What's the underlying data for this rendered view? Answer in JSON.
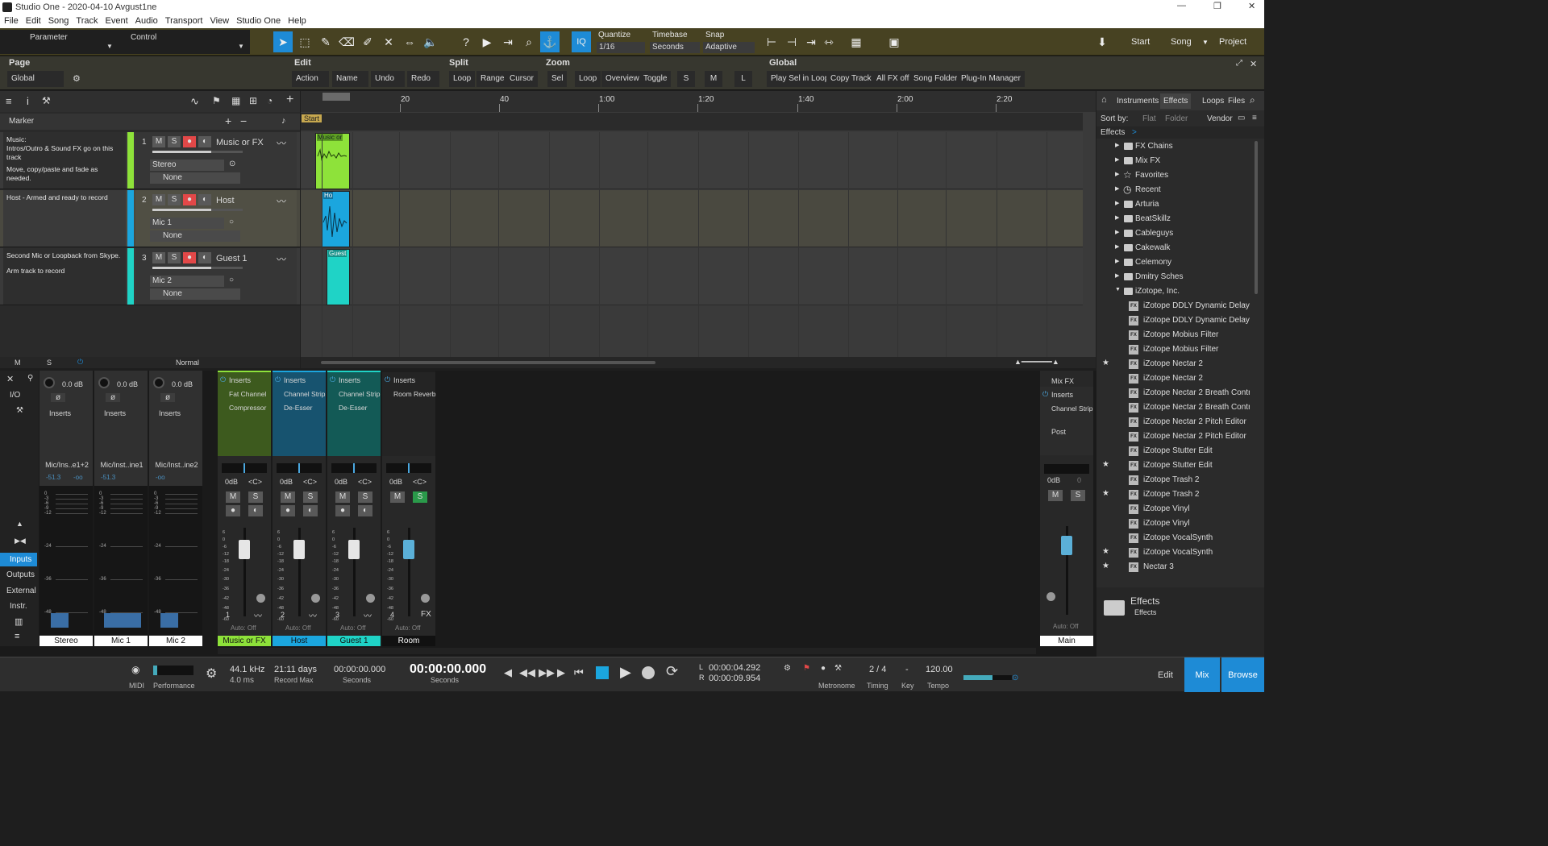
{
  "window": {
    "title": "Studio One - 2020-04-10 Avgust1ne"
  },
  "menu": [
    "File",
    "Edit",
    "Song",
    "Track",
    "Event",
    "Audio",
    "Transport",
    "View",
    "Studio One",
    "Help"
  ],
  "toolbar": {
    "parameter": "Parameter",
    "control": "Control",
    "quantize_label": "Quantize",
    "quantize_value": "1/16",
    "timebase_label": "Timebase",
    "timebase_value": "Seconds",
    "snap_label": "Snap",
    "snap_value": "Adaptive",
    "iq": "IQ",
    "start": "Start",
    "song": "Song",
    "project": "Project"
  },
  "editbar": {
    "page_label": "Page",
    "page_value": "Global",
    "edit_label": "Edit",
    "action": "Action",
    "name": "Name",
    "undo": "Undo",
    "redo": "Redo",
    "split_label": "Split",
    "loop": "Loop",
    "range": "Range",
    "cursor": "Cursor",
    "zoom_label": "Zoom",
    "sel": "Sel",
    "zloop": "Loop",
    "overview": "Overview",
    "toggle": "Toggle",
    "s": "S",
    "m": "M",
    "l": "L",
    "global_label": "Global",
    "play_sel_loop": "Play Sel in Loop",
    "copy_track": "Copy Track",
    "all_fx_off": "All FX off",
    "song_folder": "Song Folder",
    "plugin_manager": "Plug-In Manager"
  },
  "marker": {
    "label": "Marker"
  },
  "tracks": [
    {
      "num": "1",
      "name": "Music or FX",
      "note1": "Music:",
      "note2": "Intros/Outro & Sound FX go on this track",
      "note3": "Move, copy/paste and fade as needed.",
      "input": "Stereo",
      "output": "None",
      "color": "#8ee23a",
      "clip": "Music or"
    },
    {
      "num": "2",
      "name": "Host",
      "note1": "Host - Armed and ready to record",
      "note2": "",
      "note3": "",
      "input": "Mic 1",
      "output": "None",
      "color": "#1ba6de",
      "clip": "Ho"
    },
    {
      "num": "3",
      "name": "Guest 1",
      "note1": "Second Mic or Loopback from Skype.",
      "note2": "Arm track to record",
      "note3": "",
      "input": "Mic 2",
      "output": "None",
      "color": "#1fd3c6",
      "clip": "Guest"
    }
  ],
  "tl_footer": {
    "m": "M",
    "s": "S",
    "mode": "Normal"
  },
  "ruler": {
    "start": "Start",
    "ticks": [
      "20",
      "40",
      "1:00",
      "1:20",
      "1:40",
      "2:00",
      "2:20"
    ]
  },
  "browser": {
    "tabs": [
      "Instruments",
      "Effects",
      "Loops",
      "Files"
    ],
    "sort_label": "Sort by:",
    "sort_flat": "Flat",
    "sort_folder": "Folder",
    "sort_vendor": "Vendor",
    "path": "Effects",
    "items": [
      {
        "label": "FX Chains",
        "kind": "folder",
        "star": false
      },
      {
        "label": "Mix FX",
        "kind": "folder",
        "star": false
      },
      {
        "label": "Favorites",
        "kind": "star",
        "star": false
      },
      {
        "label": "Recent",
        "kind": "clock",
        "star": false
      },
      {
        "label": "Arturia",
        "kind": "folder",
        "star": false
      },
      {
        "label": "BeatSkillz",
        "kind": "folder",
        "star": false
      },
      {
        "label": "Cableguys",
        "kind": "folder",
        "star": false
      },
      {
        "label": "Cakewalk",
        "kind": "folder",
        "star": false
      },
      {
        "label": "Celemony",
        "kind": "folder",
        "star": false
      },
      {
        "label": "Dmitry Sches",
        "kind": "folder",
        "star": false
      },
      {
        "label": "iZotope, Inc.",
        "kind": "openfolder",
        "star": false
      },
      {
        "label": "iZotope DDLY Dynamic Delay",
        "kind": "fx",
        "star": false
      },
      {
        "label": "iZotope DDLY Dynamic Delay",
        "kind": "fx",
        "star": false
      },
      {
        "label": "iZotope Mobius Filter",
        "kind": "fx",
        "star": false
      },
      {
        "label": "iZotope Mobius Filter",
        "kind": "fx",
        "star": false
      },
      {
        "label": "iZotope Nectar 2",
        "kind": "fx",
        "star": true
      },
      {
        "label": "iZotope Nectar 2",
        "kind": "fx",
        "star": false
      },
      {
        "label": "iZotope Nectar 2 Breath Contr",
        "kind": "fx",
        "star": false
      },
      {
        "label": "iZotope Nectar 2 Breath Contr",
        "kind": "fx",
        "star": false
      },
      {
        "label": "iZotope Nectar 2 Pitch Editor",
        "kind": "fx",
        "star": false
      },
      {
        "label": "iZotope Nectar 2 Pitch Editor",
        "kind": "fx",
        "star": false
      },
      {
        "label": "iZotope Stutter Edit",
        "kind": "fx",
        "star": false
      },
      {
        "label": "iZotope Stutter Edit",
        "kind": "fx",
        "star": true
      },
      {
        "label": "iZotope Trash 2",
        "kind": "fx",
        "star": false
      },
      {
        "label": "iZotope Trash 2",
        "kind": "fx",
        "star": true
      },
      {
        "label": "iZotope Vinyl",
        "kind": "fx",
        "star": false
      },
      {
        "label": "iZotope Vinyl",
        "kind": "fx",
        "star": false
      },
      {
        "label": "iZotope VocalSynth",
        "kind": "fx",
        "star": false
      },
      {
        "label": "iZotope VocalSynth",
        "kind": "fx",
        "star": true
      },
      {
        "label": "Nectar 3",
        "kind": "fx",
        "star": true
      }
    ],
    "footer_title": "Effects",
    "footer_sub": "Effects"
  },
  "mixer": {
    "io": "I/O",
    "side": [
      "Inputs",
      "Outputs",
      "External",
      "Instr."
    ],
    "inputs": [
      {
        "gain": "0.0 dB",
        "name": "Mic/Ins..e1+2",
        "level": "-51.3",
        "peak": "-oo",
        "label": "Stereo"
      },
      {
        "gain": "0.0 dB",
        "name": "Mic/Inst..ine1",
        "level": "-51.3",
        "peak": "",
        "label": "Mic 1"
      },
      {
        "gain": "0.0 dB",
        "name": "Mic/Inst..ine2",
        "level": "-oo",
        "peak": "",
        "label": "Mic 2"
      }
    ],
    "inserts": "Inserts",
    "scale": [
      "0",
      "-3",
      "-6",
      "-9",
      "-12",
      "-24",
      "-36",
      "-48",
      "-60"
    ],
    "fscale": [
      "6",
      "0",
      "-6",
      "-12",
      "-18",
      "-24",
      "-30",
      "-36",
      "-42",
      "-48",
      "-60"
    ],
    "channels": [
      {
        "num": "1",
        "name": "Music or FX",
        "fx1": "Fat Channel",
        "fx2": "Compressor",
        "vol": "0dB",
        "pan": "<C>",
        "auto": "Auto: Off",
        "color": "#8ee23a",
        "bg": "#3d5a1e"
      },
      {
        "num": "2",
        "name": "Host",
        "fx1": "Channel Strip",
        "fx2": "De-Esser",
        "vol": "0dB",
        "pan": "<C>",
        "auto": "Auto: Off",
        "color": "#1ba6de",
        "bg": "#17536f"
      },
      {
        "num": "3",
        "name": "Guest 1",
        "fx1": "Channel Strip",
        "fx2": "De-Esser",
        "vol": "0dB",
        "pan": "<C>",
        "auto": "Auto: Off",
        "color": "#1fd3c6",
        "bg": "#135a56"
      },
      {
        "num": "4",
        "name": "Room",
        "fx1": "Room Reverb",
        "fx2": "",
        "vol": "0dB",
        "pan": "<C>",
        "auto": "Auto: Off",
        "color": "#1e1e1e",
        "bg": "#242424",
        "fx": "FX"
      }
    ],
    "main": {
      "title": "Mix FX",
      "inserts": "Inserts",
      "fx1": "Channel Strip",
      "post": "Post",
      "vol": "0dB",
      "pan": "0",
      "auto": "Auto: Off",
      "name": "Main"
    },
    "m": "M",
    "s": "S"
  },
  "transport": {
    "midi": "MIDI",
    "performance": "Performance",
    "rate": "44.1 kHz",
    "latency": "4.0 ms",
    "record_max_value": "21:11 days",
    "record_max": "Record Max",
    "seconds_small": "00:00:00.000",
    "seconds_small_label": "Seconds",
    "seconds_big": "00:00:00.000",
    "seconds_big_label": "Seconds",
    "l_label": "L",
    "l_time": "00:00:04.292",
    "r_label": "R",
    "r_time": "00:00:09.954",
    "metronome": "Metronome",
    "timing_value": "2 / 4",
    "timing": "Timing",
    "key_value": "-",
    "key": "Key",
    "tempo_value": "120.00",
    "tempo": "Tempo",
    "edit": "Edit",
    "mix": "Mix",
    "browse": "Browse"
  }
}
